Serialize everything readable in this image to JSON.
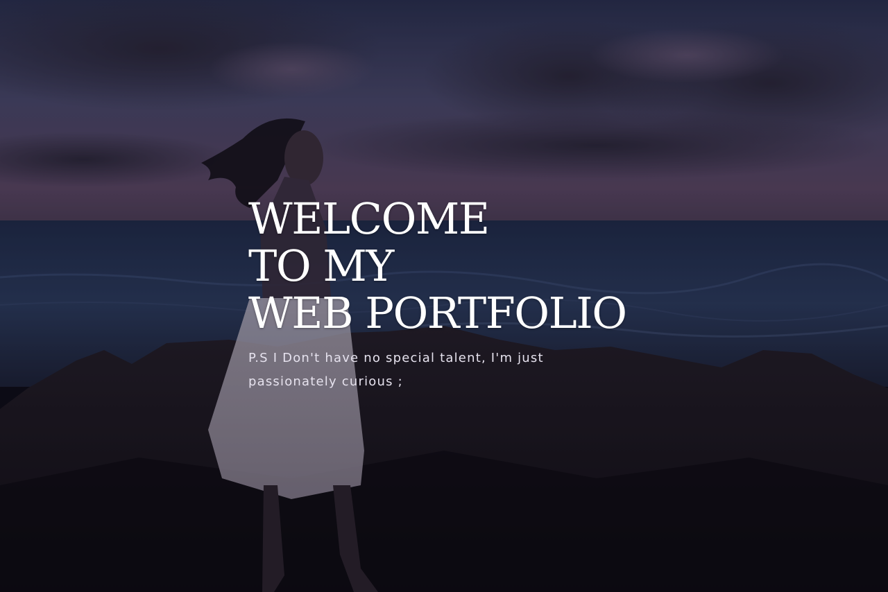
{
  "hero": {
    "title_lines": [
      "WELCOME",
      "TO MY",
      "WEB PORTFOLIO"
    ],
    "tagline": "P.S I Don't have no special talent, I'm just passionately curious ;"
  },
  "colors": {
    "sky_top": "#3d4566",
    "sky_horizon": "#5e4a6a",
    "sea": "#2b3c5e",
    "rocks": "#161319",
    "text": "#ffffff"
  }
}
